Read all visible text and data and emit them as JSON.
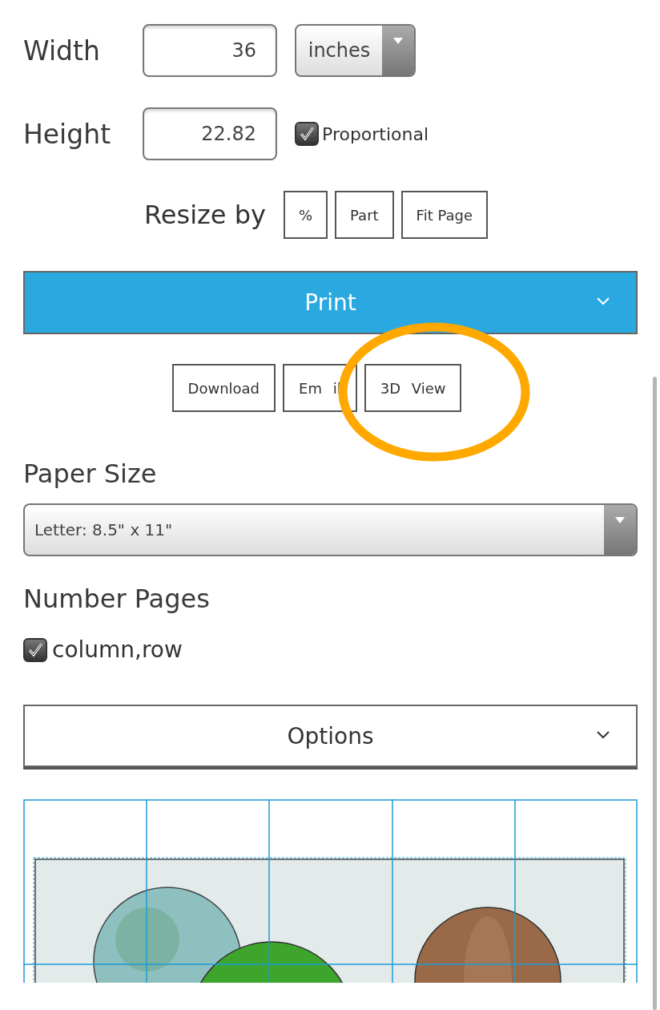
{
  "size": {
    "width_label": "Width",
    "width_value": "36",
    "unit": "inches",
    "height_label": "Height",
    "height_value": "22.82",
    "proportional": {
      "label": "Proportional",
      "checked": true
    }
  },
  "resize": {
    "label": "Resize by",
    "buttons": [
      "%",
      "Part",
      "Fit Page"
    ]
  },
  "print": {
    "label": "Print",
    "expanded": false
  },
  "actions": [
    "Download",
    "Em il",
    "3D View"
  ],
  "paper_size": {
    "label": "Paper Size",
    "value": "Letter: 8.5\" x 11\""
  },
  "number_pages": {
    "label": "Number Pages",
    "option": {
      "label": "column,row",
      "checked": true
    }
  },
  "options": {
    "label": "Options",
    "expanded": false
  }
}
